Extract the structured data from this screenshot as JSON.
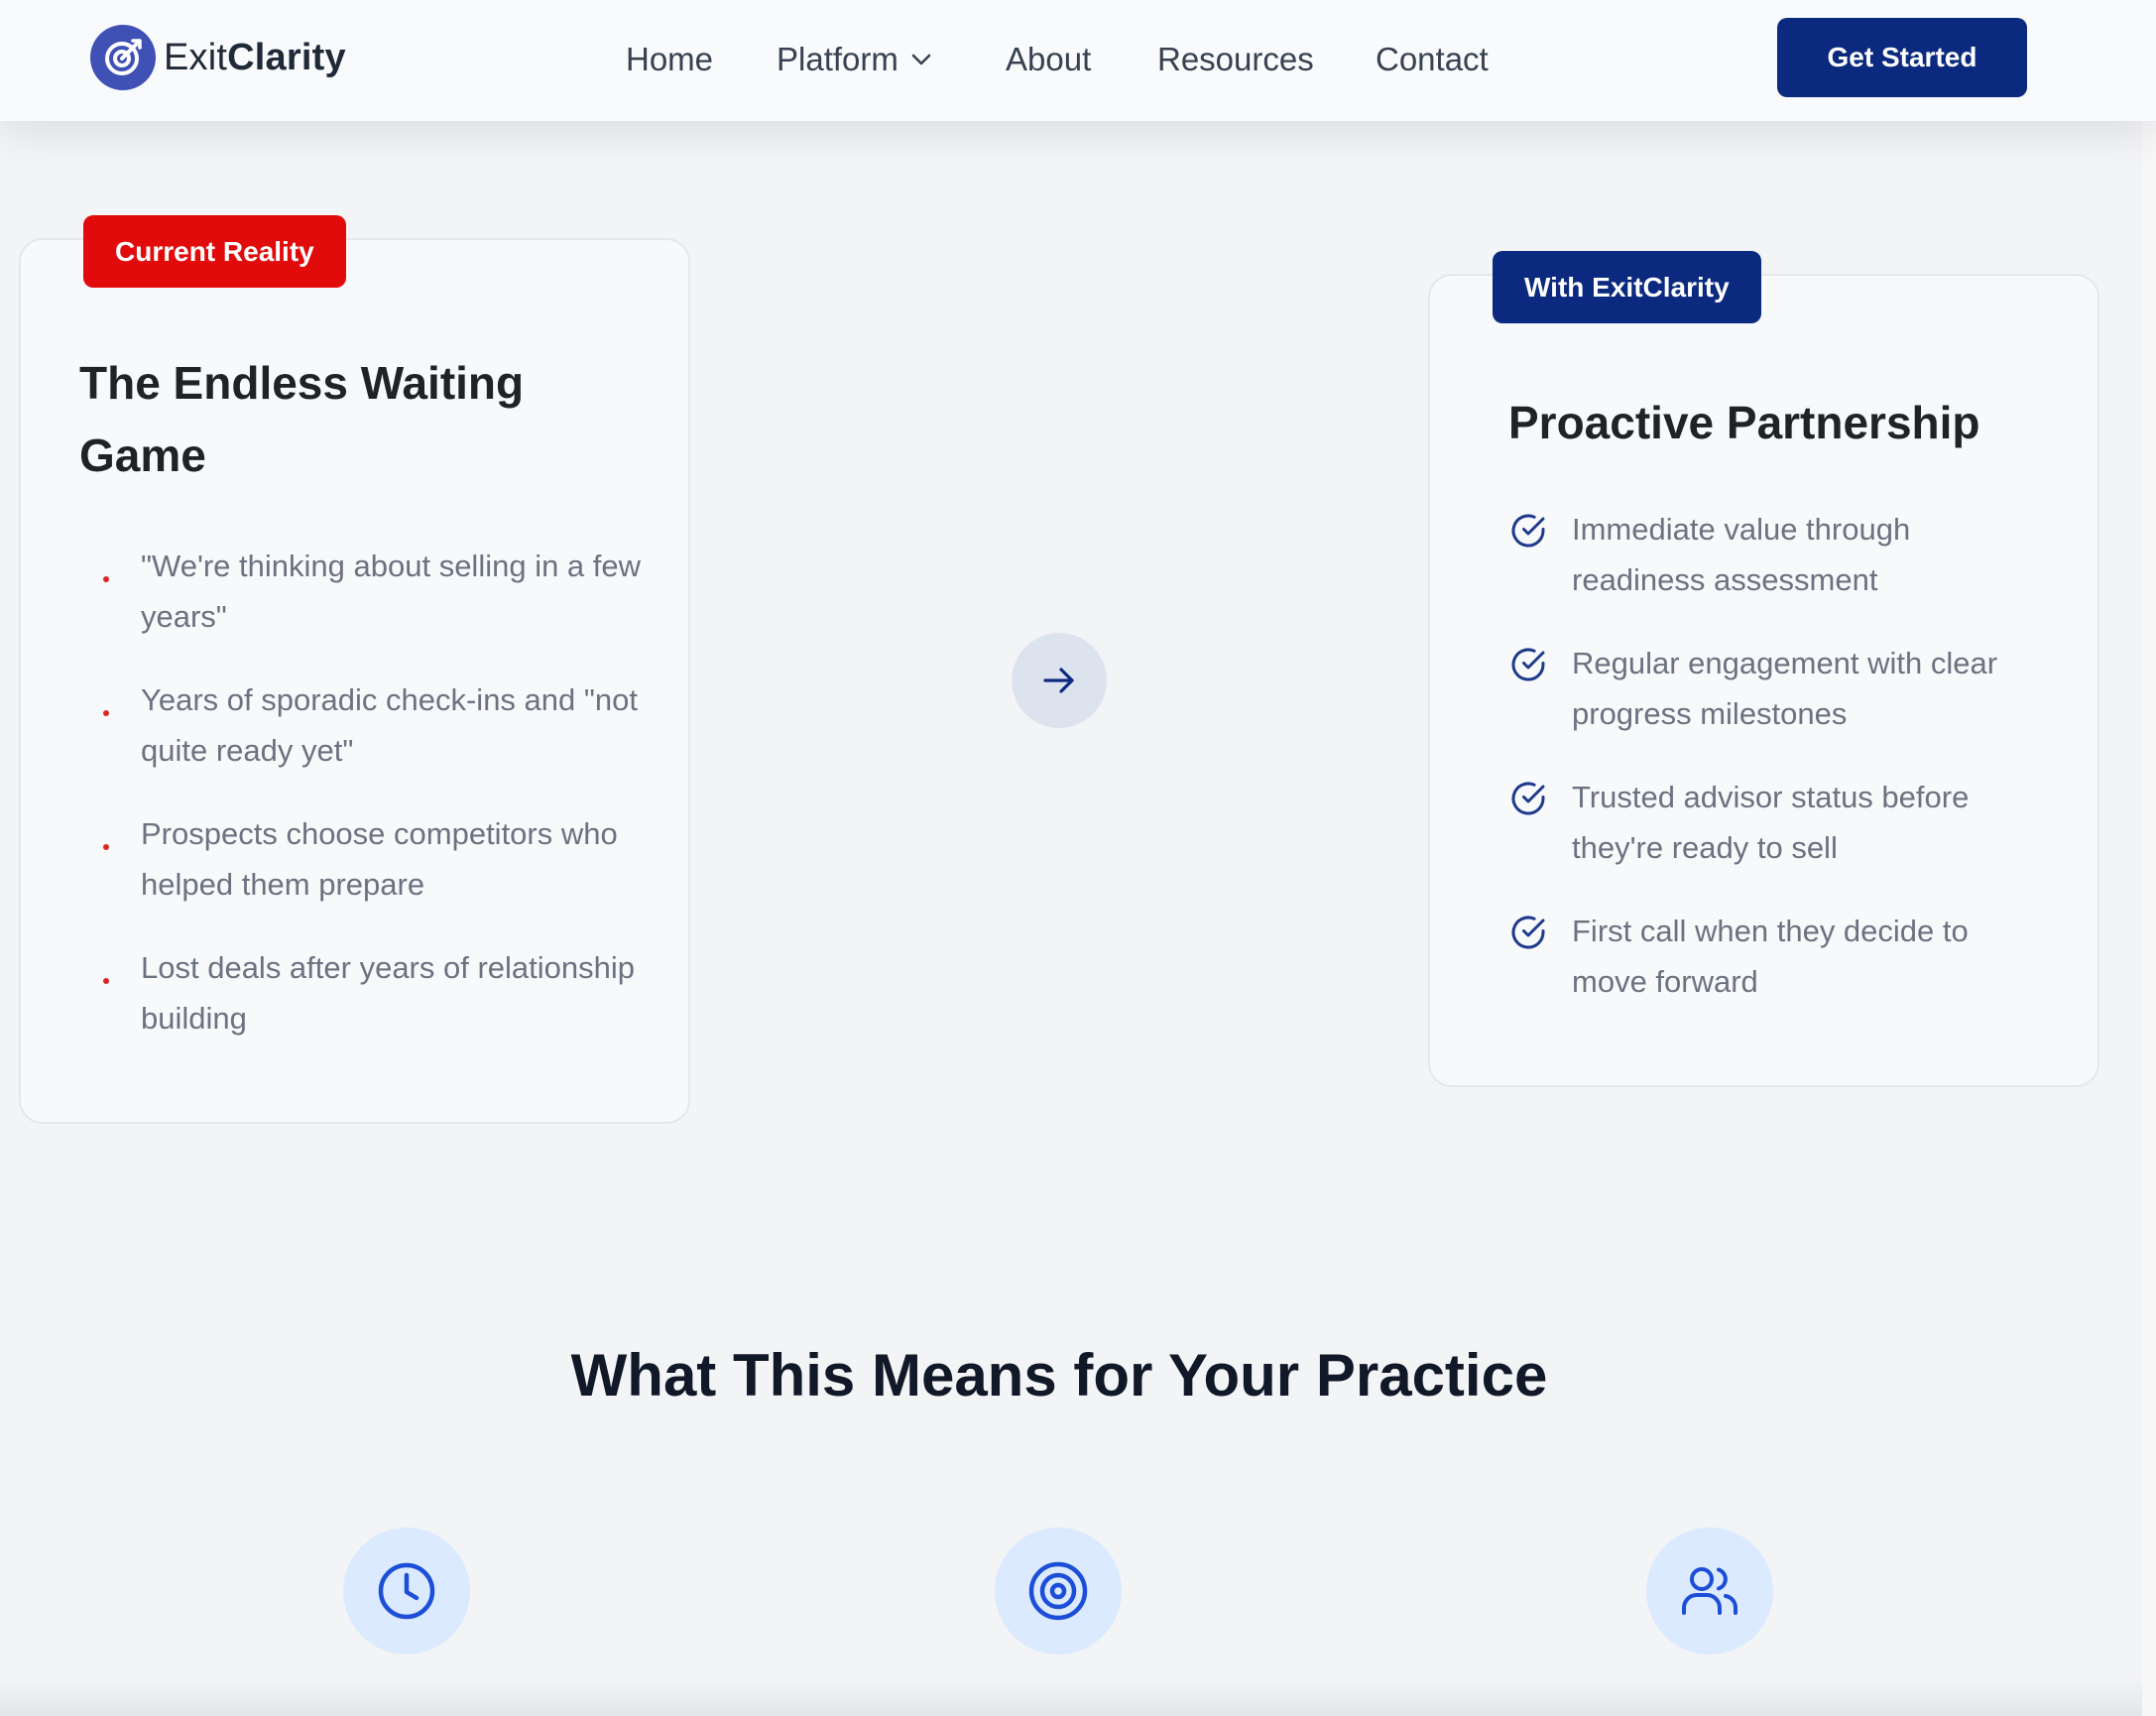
{
  "nav": {
    "logo": {
      "part1": "Exit",
      "part2": "Clarity",
      "icon": "target-icon"
    },
    "links": [
      "Home",
      "Platform",
      "About",
      "Resources",
      "Contact"
    ],
    "platform_icon": "chevron-down-icon",
    "cta": "Get Started"
  },
  "current": {
    "badge": "Current Reality",
    "title": "The Endless Waiting Game",
    "items": [
      "\"We're thinking about selling in a few years\"",
      "Years of sporadic check-ins and \"not quite ready yet\"",
      "Prospects choose competitors who helped them prepare",
      "Lost deals after years of relationship building"
    ]
  },
  "future": {
    "badge": "With ExitClarity",
    "title": "Proactive Partnership",
    "items": [
      "Immediate value through readiness assessment",
      "Regular engagement with clear progress milestones",
      "Trusted advisor status before they're ready to sell",
      "First call when they decide to move forward"
    ]
  },
  "transition_icon": "arrow-right-icon",
  "practice": {
    "title": "What This Means for Your Practice",
    "icons": [
      "clock-icon",
      "target-icon",
      "users-icon"
    ]
  },
  "colors": {
    "brand_navy": "#0b2a7f",
    "alert_red": "#e20b0b",
    "accent_blue": "#1d4ed8",
    "icon_circle": "#dbeafe"
  }
}
